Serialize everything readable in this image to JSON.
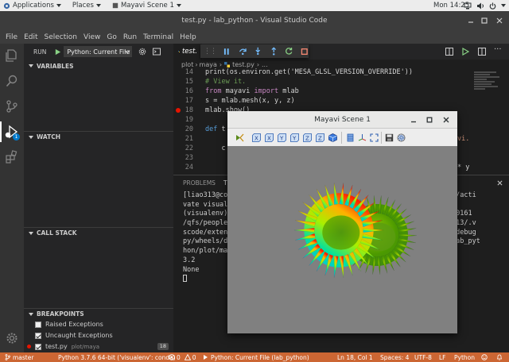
{
  "gnome": {
    "applications": "Applications",
    "places": "Places",
    "active_window": "Mayavi Scene 1",
    "clock": "Mon 14:25"
  },
  "vscode": {
    "title": "test.py - lab_python - Visual Studio Code",
    "menu": [
      "File",
      "Edit",
      "Selection",
      "View",
      "Go",
      "Run",
      "Terminal",
      "Help"
    ],
    "sidebar": {
      "run_label": "RUN",
      "config": "Python: Current File",
      "sections": {
        "variables": "VARIABLES",
        "watch": "WATCH",
        "call_stack": "CALL STACK",
        "breakpoints": "BREAKPOINTS"
      },
      "breakpoints": [
        {
          "label": "Raised Exceptions",
          "checked": false
        },
        {
          "label": "Uncaught Exceptions",
          "checked": true
        },
        {
          "label": "test.py",
          "path": "plot/maya",
          "line": "18",
          "checked": true
        }
      ]
    },
    "editor": {
      "tab": "test.",
      "breadcrumb": {
        "folder1": "plot",
        "folder2": "maya",
        "file": "test.py",
        "more": "..."
      },
      "lines": [
        {
          "n": "14",
          "text": "print(os.environ.get('MESA_GLSL_VERSION_OVERRIDE'))"
        },
        {
          "n": "15",
          "text": "# View it."
        },
        {
          "n": "16",
          "kw": "from",
          "mid": " mayavi ",
          "kw2": "import",
          "rest": " mlab"
        },
        {
          "n": "17",
          "text": "s = mlab.mesh(x, y, z)"
        },
        {
          "n": "18",
          "text": "mlab.show()"
        },
        {
          "n": "19",
          "text": ""
        },
        {
          "n": "20",
          "kw": "def",
          "rest": " t"
        },
        {
          "n": "21",
          "text": "    "
        },
        {
          "n": "22",
          "text": "    c"
        },
        {
          "n": "23",
          "text": "    "
        },
        {
          "n": "24",
          "text": ""
        }
      ],
      "line21_tail": "vi.",
      "line24_tail": "* y"
    },
    "panel": {
      "tabs": [
        "PROBLEMS",
        "T"
      ],
      "terminal_left": [
        "[liao313@co",
        "vate visual",
        "(visualenv)",
        "/qfs/people",
        "scode/exten",
        "py/wheels/d",
        "hon/plot/ma",
        "3.2",
        "None",
        ""
      ],
      "terminal_right": [
        "n/acti",
        "",
        "40161",
        "313/.v",
        "/debug",
        "lab_pyt",
        "",
        "",
        "",
        ""
      ]
    },
    "status": {
      "branch": "master",
      "python": "Python 3.7.6 64-bit ('visualenv': conda)",
      "errors": "0",
      "warnings": "0",
      "run_config": "Python: Current File (lab_python)",
      "position": "Ln 18, Col 1",
      "spaces": "Spaces: 4",
      "encoding": "UTF-8",
      "eol": "LF",
      "language": "Python"
    }
  },
  "mayavi": {
    "title": "Mayavi Scene 1",
    "toolbar_axes": [
      "X",
      "X",
      "Y",
      "Y",
      "Z",
      "Z"
    ]
  },
  "colors": {
    "status_bar": "#cc6633",
    "breakpoint": "#e51400",
    "scene_background": "#808080"
  }
}
